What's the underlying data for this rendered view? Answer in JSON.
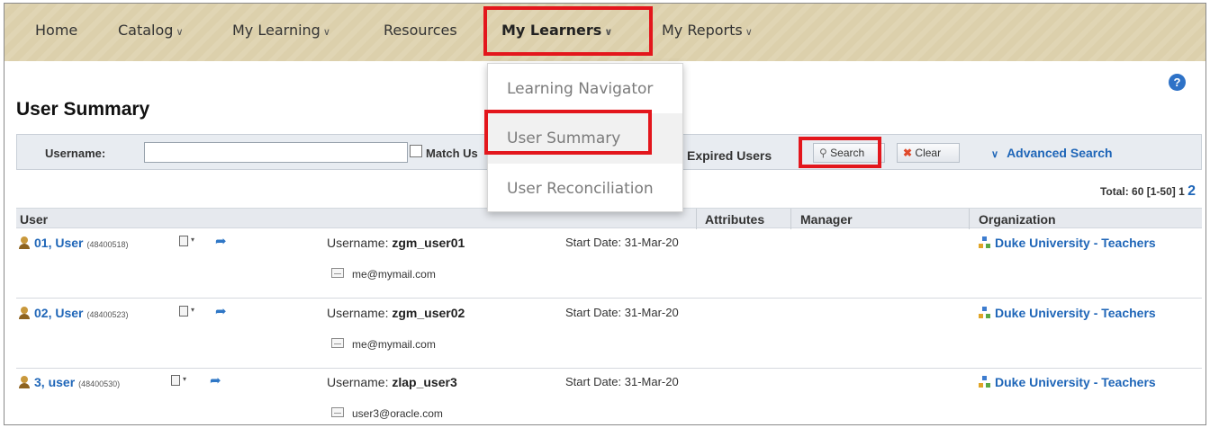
{
  "nav": {
    "items": [
      {
        "label": "Home"
      },
      {
        "label": "Catalog",
        "chevron": "∨"
      },
      {
        "label": "My Learning",
        "chevron": "∨"
      },
      {
        "label": "Resources"
      },
      {
        "label": "My Learners",
        "chevron": "∨",
        "active": true
      },
      {
        "label": "My Reports",
        "chevron": "∨"
      }
    ]
  },
  "dropdown": {
    "items": [
      {
        "label": "Learning Navigator"
      },
      {
        "label": "User Summary",
        "selected": true
      },
      {
        "label": "User Reconciliation"
      }
    ]
  },
  "page": {
    "title": "User Summary",
    "help_icon": "?"
  },
  "search": {
    "username_label": "Username:",
    "username_value": "",
    "match_label": "Match Us",
    "expired_label": "Expired Users",
    "search_button": "Search",
    "clear_button": "Clear",
    "advanced_label": "Advanced Search",
    "chevron": "∨"
  },
  "pagination": {
    "total_text": "Total: 60 [1-50] 1",
    "page2": "2"
  },
  "table": {
    "headers": {
      "user": "User",
      "attributes": "Attributes",
      "manager": "Manager",
      "organization": "Organization"
    },
    "rows": [
      {
        "name": "01, User",
        "id": "(48400518)",
        "username_label": "Username:",
        "username": "zgm_user01",
        "email": "me@mymail.com",
        "start_date": "Start Date: 31-Mar-20",
        "organization": "Duke University - Teachers"
      },
      {
        "name": "02, User",
        "id": "(48400523)",
        "username_label": "Username:",
        "username": "zgm_user02",
        "email": "me@mymail.com",
        "start_date": "Start Date: 31-Mar-20",
        "organization": "Duke University - Teachers"
      },
      {
        "name": "3, user",
        "id": "(48400530)",
        "username_label": "Username:",
        "username": "zlap_user3",
        "email": "user3@oracle.com",
        "start_date": "Start Date: 31-Mar-20",
        "organization": "Duke University - Teachers"
      }
    ]
  },
  "colors": {
    "highlight": "#e3161c",
    "link": "#1f66b8",
    "nav_bg": "#dcd0ac"
  }
}
